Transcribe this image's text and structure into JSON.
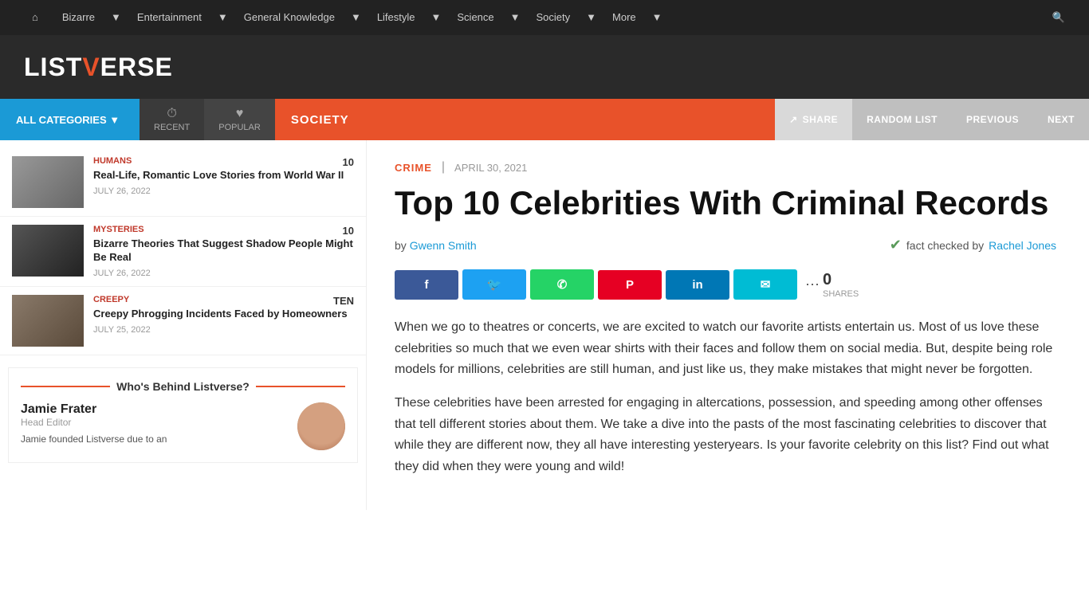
{
  "topnav": {
    "home_icon": "⌂",
    "items": [
      {
        "label": "Bizarre",
        "has_arrow": true
      },
      {
        "label": "Entertainment",
        "has_arrow": true
      },
      {
        "label": "General Knowledge",
        "has_arrow": true
      },
      {
        "label": "Lifestyle",
        "has_arrow": true
      },
      {
        "label": "Science",
        "has_arrow": true
      },
      {
        "label": "Society",
        "has_arrow": true
      },
      {
        "label": "More",
        "has_arrow": true
      }
    ],
    "search_icon": "🔍"
  },
  "logo": {
    "text_before": "LIST",
    "text_v": "V",
    "text_after": "ERSE"
  },
  "catbar": {
    "all_label": "ALL CATEGORIES ▼",
    "recent_label": "RECENT",
    "recent_icon": "⏱",
    "popular_label": "POPULAR",
    "popular_icon": "♥",
    "section_label": "SOCIETY",
    "share_label": "SHARE",
    "share_icon": "↗",
    "random_label": "RANDOM LIST",
    "previous_label": "PREVIOUS",
    "next_label": "NEXT"
  },
  "sidebar": {
    "items": [
      {
        "category": "HUMANS",
        "cat_class": "cat-humans",
        "thumb_class": "thumb-humans",
        "count": "10",
        "title": "Real-Life, Romantic Love Stories from World War II",
        "date": "JULY 26, 2022"
      },
      {
        "category": "MYSTERIES",
        "cat_class": "cat-mysteries",
        "thumb_class": "thumb-mysteries",
        "count": "10",
        "title": "Bizarre Theories That Suggest Shadow People Might Be Real",
        "date": "JULY 26, 2022"
      },
      {
        "category": "CREEPY",
        "cat_class": "cat-creepy",
        "thumb_class": "thumb-creepy",
        "count": "Ten",
        "title": "Creepy Phrogging Incidents Faced by Homeowners",
        "date": "JULY 25, 2022"
      }
    ],
    "who_title": "Who's Behind Listverse?",
    "who_name": "Jamie Frater",
    "who_role": "Head Editor",
    "who_desc": "Jamie founded Listverse due to an"
  },
  "article": {
    "category": "CRIME",
    "date": "APRIL 30, 2021",
    "title": "Top 10 Celebrities With Criminal Records",
    "by_text": "by",
    "author": "Gwenn Smith",
    "fact_check_text": "fact checked by",
    "fact_checker": "Rachel Jones",
    "share_count": "0",
    "shares_label": "SHARES",
    "share_icon": "⋯",
    "social_buttons": [
      {
        "icon": "f",
        "class": "btn-facebook"
      },
      {
        "icon": "🐦",
        "class": "btn-twitter"
      },
      {
        "icon": "✆",
        "class": "btn-whatsapp"
      },
      {
        "icon": "P",
        "class": "btn-pinterest"
      },
      {
        "icon": "in",
        "class": "btn-linkedin"
      },
      {
        "icon": "✉",
        "class": "btn-email"
      }
    ],
    "paragraph1": "When we go to theatres or concerts, we are excited to watch our favorite artists entertain us. Most of us love these celebrities so much that we even wear shirts with their faces and follow them on social media.  But, despite being role models for millions, celebrities are still human, and just like us, they make mistakes that might never be forgotten.",
    "paragraph2": "These celebrities have been arrested for engaging in altercations, possession, and speeding among other offenses that tell different stories about them. We take a dive into the pasts of the most fascinating celebrities to discover that while they are different now, they all have interesting yesteryears. Is your favorite celebrity on this list? Find out what they did when they were young and wild!"
  }
}
